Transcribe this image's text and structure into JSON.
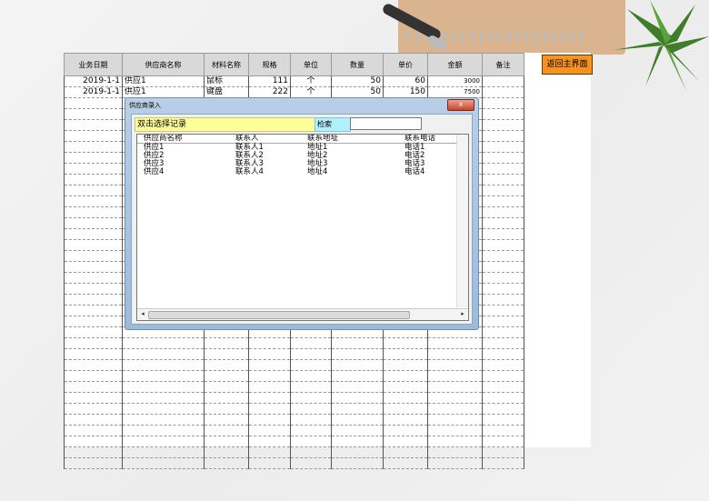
{
  "sheet": {
    "headers": [
      "业务日期",
      "供应商名称",
      "材料名称",
      "规格",
      "单位",
      "数量",
      "单价",
      "金额",
      "备注"
    ],
    "rows": [
      [
        "2019-1-1",
        "供应1",
        "鼠标",
        "111",
        "个",
        "50",
        "60",
        "3000",
        ""
      ],
      [
        "2019-1-1",
        "供应1",
        "键盘",
        "222",
        "个",
        "50",
        "150",
        "7500",
        ""
      ]
    ],
    "return_button": "返回主界面"
  },
  "dialog": {
    "title": "供应商录入",
    "close": "x",
    "hint": "双击选择记录",
    "search_label": "检索",
    "search_value": "",
    "list": {
      "headers": [
        "供应商名称",
        "联系人",
        "联系地址",
        "联系电话"
      ],
      "rows": [
        [
          "供应1",
          "联系人1",
          "地址1",
          "电话1"
        ],
        [
          "供应2",
          "联系人2",
          "地址2",
          "电话2"
        ],
        [
          "供应3",
          "联系人3",
          "地址3",
          "电话3"
        ],
        [
          "供应4",
          "联系人4",
          "地址4",
          "电话4"
        ]
      ],
      "scroll_left": "◂",
      "scroll_right": "▸"
    }
  },
  "colors": {
    "header_bg": "#d9d9d9",
    "return_button_bg": "#f7931e",
    "hint_bg": "#ffff99",
    "search_label_bg": "#b3f0ff"
  }
}
